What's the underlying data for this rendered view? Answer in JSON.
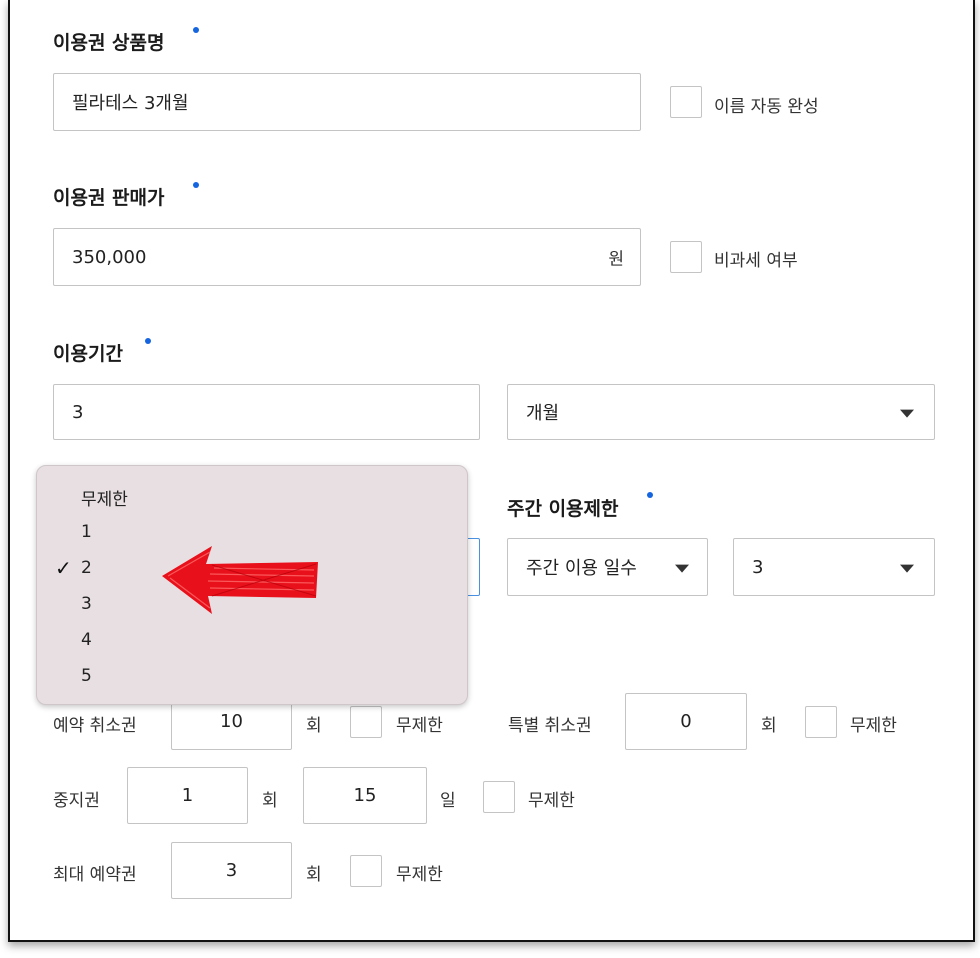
{
  "product_name": {
    "label": "이용권 상품명",
    "value": "필라테스 3개월",
    "auto_name_label": "이름 자동 완성"
  },
  "price": {
    "label": "이용권 판매가",
    "value": "350,000",
    "unit": "원",
    "tax_free_label": "비과세 여부"
  },
  "period": {
    "label": "이용기간",
    "value": "3",
    "unit_select": "개월"
  },
  "weekly_limit": {
    "label": "주간 이용제한",
    "type_select": "주간 이용 일수",
    "count_select": "3"
  },
  "dropdown": {
    "options": [
      "무제한",
      "1",
      "2",
      "3",
      "4",
      "5"
    ],
    "selected_index": 2,
    "check_mark": "✓"
  },
  "cancel": {
    "label": "예약 취소권",
    "value": "10",
    "unit": "회",
    "unlimited_label": "무제한"
  },
  "special_cancel": {
    "label": "특별 취소권",
    "value": "0",
    "unit": "회",
    "unlimited_label": "무제한"
  },
  "pause": {
    "label": "중지권",
    "count": "1",
    "count_unit": "회",
    "days": "15",
    "days_unit": "일",
    "unlimited_label": "무제한"
  },
  "max_reservation": {
    "label": "최대 예약권",
    "value": "3",
    "unit": "회",
    "unlimited_label": "무제한"
  },
  "colors": {
    "required_dot": "#1565e0",
    "menu_bg": "#e7dfe2",
    "arrow": "#e8101a"
  },
  "annotation": {
    "icon": "red-arrow-left-icon"
  }
}
